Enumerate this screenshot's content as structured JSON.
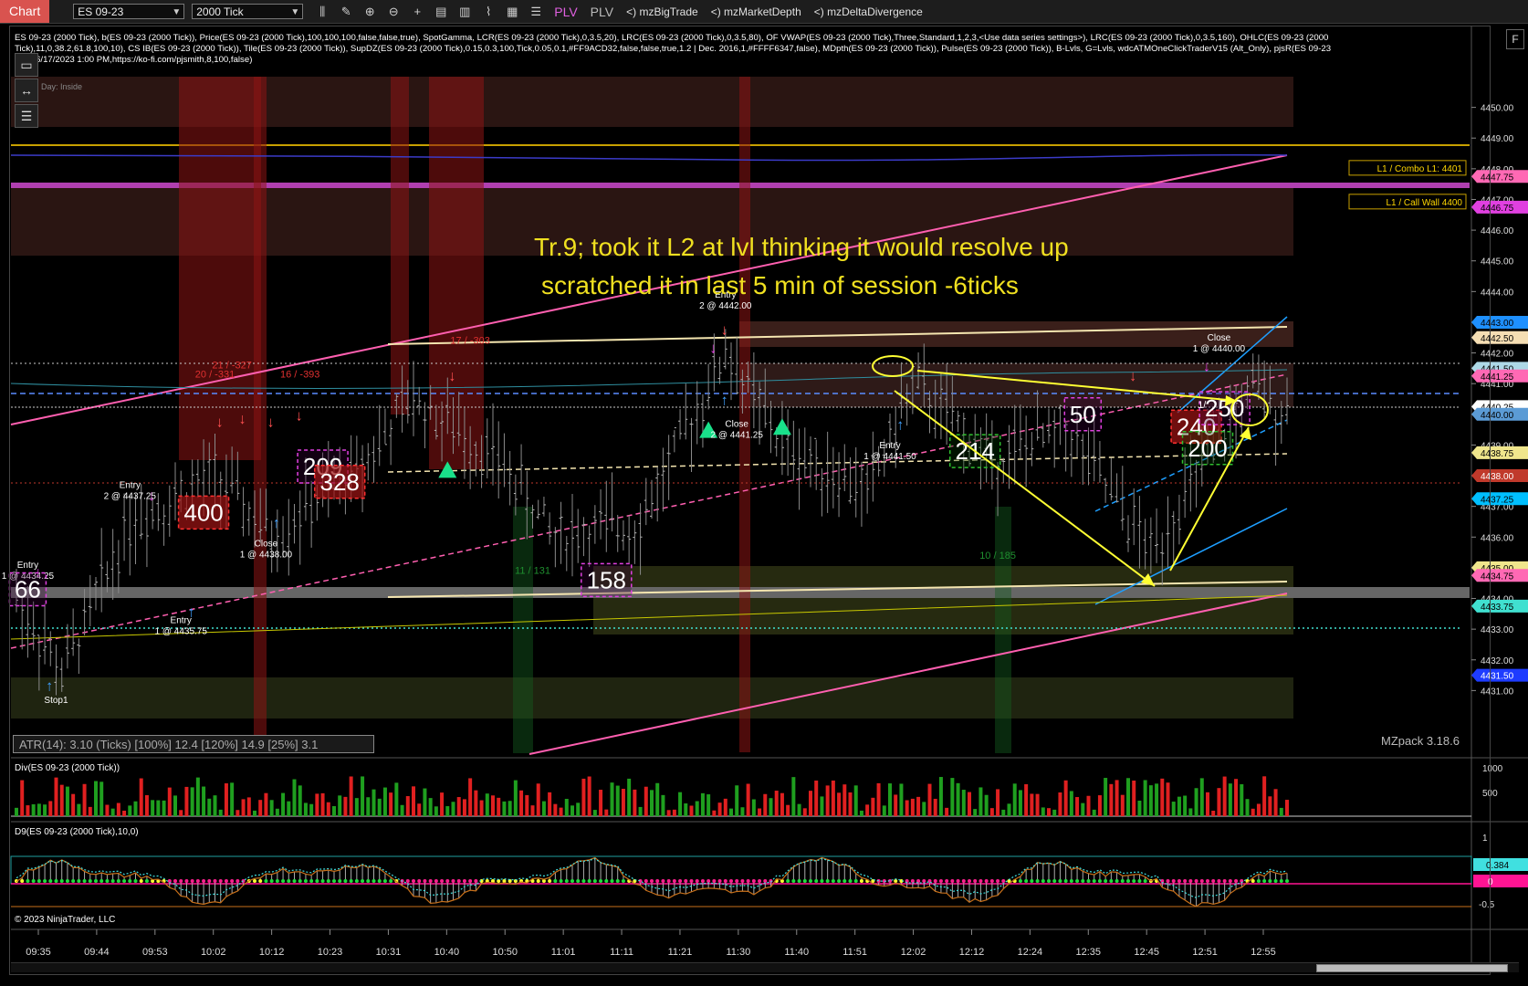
{
  "toolbar": {
    "chart_tab": "Chart",
    "instrument": "ES 09-23",
    "interval": "2000 Tick",
    "plv1": "PLV",
    "plv2": "PLV",
    "indicators": [
      "mzBigTrade",
      "mzMarketDepth",
      "mzDeltaDivergence"
    ],
    "icons": [
      "bar-type-icon",
      "pencil-icon",
      "zoom-in-icon",
      "zoom-out-icon",
      "crosshair-icon",
      "data-box-icon",
      "properties-icon",
      "strategies-icon",
      "drawing-tools-icon",
      "list-icon"
    ]
  },
  "info_line1": "ES 09-23 (2000 Tick), b(ES 09-23 (2000 Tick)), Price(ES 09-23 (2000 Tick),100,100,100,false,false,true), SpotGamma, LCR(ES 09-23 (2000 Tick),0,3.5,20), LRC(ES 09-23 (2000 Tick),0,3.5,80), OF VWAP(ES 09-23 (2000 Tick),Three,Standard,1,2,3,<Use data series settings>), LRC(ES 09-23 (2000 Tick),0,3.5,160), OHLC(ES 09-23 (2000",
  "info_line2": "Tick),11,0,38.2,61.8,100,10), CS IB(ES 09-23 (2000 Tick)), Tile(ES 09-23 (2000 Tick)), SupDZ(ES 09-23 (2000 Tick),0.15,0.3,100,Tick,0.05,0.1,#FF9ACD32,false,false,true,1.2 | Dec. 2016,1,#FFFF6347,false), MDpth(ES 09-23 (2000 Tick)), Pulse(ES 09-23 (2000 Tick)), B-Lvls, G=Lvls, wdcATMOneClickTraderV15 (Alt_Only), pjsR(ES 09-23",
  "info_line3": "Tick),6/17/2023 1:00 PM,https://ko-fi.com/pjsmith,8,100,false)",
  "day_label": "Day: Inside",
  "annotation_line1": "Tr.9; took it L2 at lvl thinking it  would resolve up",
  "annotation_line2": "scratched it in last 5 min of session  -6ticks",
  "atr_text": "ATR(14): 3.10 (Ticks) [100%] 12.4  [120%] 14.9  [25%] 3.1",
  "mzpack": "MZpack 3.18.6",
  "div_label": "Div(ES 09-23 (2000 Tick))",
  "d9_label": "D9(ES 09-23 (2000 Tick),10,0)",
  "copyright": "© 2023 NinjaTrader, LLC",
  "corner_button": "F",
  "level_tags": [
    {
      "text": "L1 / Combo L1: 4401",
      "price": 4448.0
    },
    {
      "text": "L1 / Call Wall 4400",
      "price": 4446.9
    }
  ],
  "price_axis": {
    "min": 4430.0,
    "max": 4451.0,
    "ticks": [
      "4450.00",
      "4449.00",
      "4448.00",
      "4447.00",
      "4446.00",
      "4445.00",
      "4444.00",
      "4443.00",
      "4442.00",
      "4441.00",
      "4440.00",
      "4439.00",
      "4438.00",
      "4437.00",
      "4436.00",
      "4435.00",
      "4434.00",
      "4433.00",
      "4432.00",
      "4431.00"
    ],
    "markers": [
      {
        "text": "4447.75",
        "price": 4447.75,
        "bg": "#ff69b4",
        "fg": "#000"
      },
      {
        "text": "4446.75",
        "price": 4446.75,
        "bg": "#e040e0",
        "fg": "#000"
      },
      {
        "text": "4443.00",
        "price": 4443.0,
        "bg": "#1e90ff",
        "fg": "#000"
      },
      {
        "text": "4442.50",
        "price": 4442.5,
        "bg": "#f5deb3",
        "fg": "#000"
      },
      {
        "text": "4441.50",
        "price": 4441.5,
        "bg": "#add8e6",
        "fg": "#000"
      },
      {
        "text": "4441.25",
        "price": 4441.25,
        "bg": "#ff69b4",
        "fg": "#000"
      },
      {
        "text": "4440.25",
        "price": 4440.25,
        "bg": "#ffffff",
        "fg": "#000"
      },
      {
        "text": "4440.00",
        "price": 4440.0,
        "bg": "#5b9bd5",
        "fg": "#000"
      },
      {
        "text": "4438.75",
        "price": 4438.75,
        "bg": "#f0e68c",
        "fg": "#000"
      },
      {
        "text": "4438.00",
        "price": 4438.0,
        "bg": "#c0392b",
        "fg": "#fff"
      },
      {
        "text": "4437.25",
        "price": 4437.25,
        "bg": "#00bfff",
        "fg": "#000"
      },
      {
        "text": "4435.00",
        "price": 4435.0,
        "bg": "#f0e68c",
        "fg": "#000"
      },
      {
        "text": "4434.75",
        "price": 4434.75,
        "bg": "#ff69b4",
        "fg": "#000"
      },
      {
        "text": "4433.75",
        "price": 4433.75,
        "bg": "#40e0d0",
        "fg": "#000"
      },
      {
        "text": "4431.50",
        "price": 4431.5,
        "bg": "#1e3cff",
        "fg": "#fff"
      }
    ]
  },
  "time_axis": [
    "09:35",
    "09:44",
    "09:53",
    "10:02",
    "10:12",
    "10:23",
    "10:31",
    "10:40",
    "10:50",
    "11:01",
    "11:11",
    "11:21",
    "11:30",
    "11:40",
    "11:51",
    "12:02",
    "12:12",
    "12:24",
    "12:35",
    "12:45",
    "12:51",
    "12:55"
  ],
  "div_axis": [
    "1000",
    "500"
  ],
  "d9_axis": {
    "top": "1",
    "bottom": "-0.5",
    "marker1": "0.384",
    "marker2": "0"
  },
  "trade_labels": [
    {
      "text": "Entry",
      "sub": "2 @ 4437.25",
      "bar": 20,
      "price": 4437.6
    },
    {
      "text": "Close",
      "sub": "1 @ 4438.00",
      "bar": 44,
      "price": 4435.7
    },
    {
      "text": "Entry",
      "sub": "1 @ 4435.75",
      "bar": 29,
      "price": 4433.2
    },
    {
      "text": "Entry",
      "sub": "1 @ 4434.25",
      "bar": 2,
      "price": 4435.0
    },
    {
      "text": "Stop1",
      "sub": "",
      "bar": 7,
      "price": 4430.6
    },
    {
      "text": "Entry",
      "sub": "2 @ 4442.00",
      "bar": 125,
      "price": 4443.8
    },
    {
      "text": "Close",
      "sub": "2 @ 4441.25",
      "bar": 127,
      "price": 4439.6
    },
    {
      "text": "Entry",
      "sub": "1 @ 4441.50",
      "bar": 154,
      "price": 4438.9
    },
    {
      "text": "Close",
      "sub": "1 @ 4440.00",
      "bar": 212,
      "price": 4442.4
    }
  ],
  "big_numbers": [
    {
      "text": "400",
      "bar": 33,
      "price": 4436.8,
      "style": "red"
    },
    {
      "text": "209",
      "bar": 54,
      "price": 4438.3,
      "style": "magenta"
    },
    {
      "text": "328",
      "bar": 57,
      "price": 4437.8,
      "style": "red"
    },
    {
      "text": "66",
      "bar": 2,
      "price": 4434.3,
      "style": "magenta"
    },
    {
      "text": "158",
      "bar": 104,
      "price": 4434.6,
      "style": "magenta"
    },
    {
      "text": "214",
      "bar": 169,
      "price": 4438.8,
      "style": "green"
    },
    {
      "text": "50",
      "bar": 188,
      "price": 4440.0,
      "style": "magenta"
    },
    {
      "text": "240",
      "bar": 208,
      "price": 4439.6,
      "style": "red"
    },
    {
      "text": "250",
      "bar": 213,
      "price": 4440.2,
      "style": "magenta"
    },
    {
      "text": "200",
      "bar": 210,
      "price": 4438.9,
      "style": "green"
    }
  ],
  "delta_labels": [
    {
      "text": "17 / -303",
      "bar": 80,
      "price": 4442.3,
      "color": "#e03030"
    },
    {
      "text": "20 / -331",
      "bar": 35,
      "price": 4441.2,
      "color": "#e03030"
    },
    {
      "text": "16 / -393",
      "bar": 50,
      "price": 4441.2,
      "color": "#e03030"
    },
    {
      "text": "21 / -327",
      "bar": 38,
      "price": 4441.5,
      "color": "#e03030"
    },
    {
      "text": "11 / 131",
      "bar": 91,
      "price": 4434.8,
      "color": "#1f8f2f"
    },
    {
      "text": "10 / 185",
      "bar": 173,
      "price": 4435.3,
      "color": "#1f8f2f"
    },
    {
      "text": "1/",
      "bar": 209,
      "price": 4440.2,
      "color": "#ffffff"
    }
  ]
}
